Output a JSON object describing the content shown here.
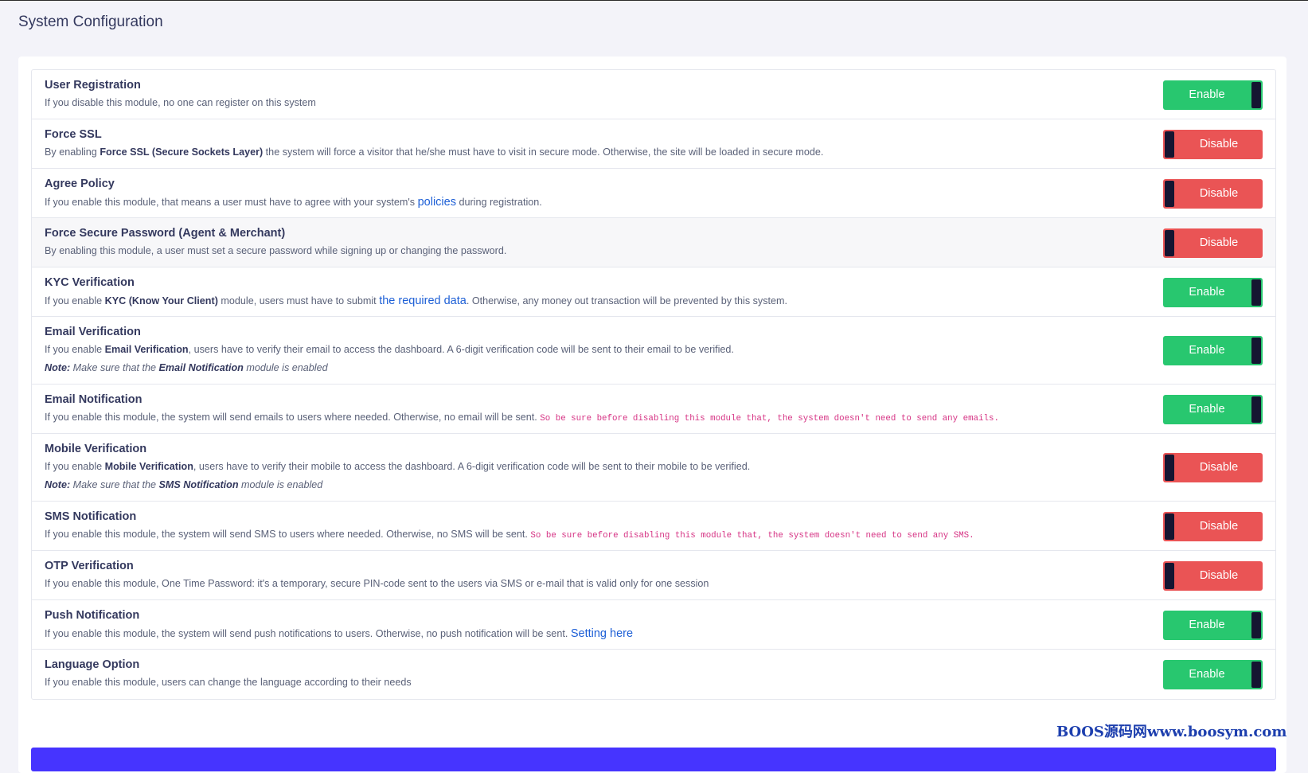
{
  "page": {
    "title": "System Configuration"
  },
  "rows": [
    {
      "title": "User Registration",
      "desc": [
        {
          "t": "text",
          "v": "If you disable this module, no one can register on this system"
        }
      ],
      "toggle": "Enable",
      "enabled": true
    },
    {
      "title": "Force SSL",
      "desc": [
        {
          "t": "text",
          "v": "By enabling "
        },
        {
          "t": "bold",
          "v": "Force SSL (Secure Sockets Layer)"
        },
        {
          "t": "text",
          "v": " the system will force a visitor that he/she must have to visit in secure mode. Otherwise, the site will be loaded in secure mode."
        }
      ],
      "toggle": "Disable",
      "enabled": false
    },
    {
      "title": "Agree Policy",
      "desc": [
        {
          "t": "text",
          "v": "If you enable this module, that means a user must have to agree with your system's "
        },
        {
          "t": "link",
          "v": "policies"
        },
        {
          "t": "text",
          "v": " during registration."
        }
      ],
      "toggle": "Disable",
      "enabled": false
    },
    {
      "title": "Force Secure Password (Agent & Merchant)",
      "desc": [
        {
          "t": "text",
          "v": "By enabling this module, a user must set a secure password while signing up or changing the password."
        }
      ],
      "toggle": "Disable",
      "enabled": false,
      "shaded": true
    },
    {
      "title": "KYC Verification",
      "desc": [
        {
          "t": "text",
          "v": "If you enable "
        },
        {
          "t": "bold",
          "v": "KYC (Know Your Client)"
        },
        {
          "t": "text",
          "v": " module, users must have to submit "
        },
        {
          "t": "link",
          "v": "the required data"
        },
        {
          "t": "text",
          "v": ". Otherwise, any money out transaction will be prevented by this system."
        }
      ],
      "toggle": "Enable",
      "enabled": true
    },
    {
      "title": "Email Verification",
      "desc": [
        {
          "t": "text",
          "v": "If you enable "
        },
        {
          "t": "bold",
          "v": "Email Verification"
        },
        {
          "t": "text",
          "v": ", users have to verify their email to access the dashboard. A 6-digit verification code will be sent to their email to be verified."
        }
      ],
      "note": [
        {
          "t": "bold",
          "v": "Note:"
        },
        {
          "t": "text",
          "v": " Make sure that the "
        },
        {
          "t": "bold",
          "v": "Email Notification"
        },
        {
          "t": "text",
          "v": " module is enabled"
        }
      ],
      "toggle": "Enable",
      "enabled": true
    },
    {
      "title": "Email Notification",
      "desc": [
        {
          "t": "text",
          "v": "If you enable this module, the system will send emails to users where needed. Otherwise, no email will be sent. "
        },
        {
          "t": "code",
          "v": "So be sure before disabling this module that, the system doesn't need to send any emails."
        }
      ],
      "toggle": "Enable",
      "enabled": true
    },
    {
      "title": "Mobile Verification",
      "desc": [
        {
          "t": "text",
          "v": "If you enable "
        },
        {
          "t": "bold",
          "v": "Mobile Verification"
        },
        {
          "t": "text",
          "v": ", users have to verify their mobile to access the dashboard. A 6-digit verification code will be sent to their mobile to be verified."
        }
      ],
      "note": [
        {
          "t": "bold",
          "v": "Note:"
        },
        {
          "t": "text",
          "v": " Make sure that the "
        },
        {
          "t": "bold",
          "v": "SMS Notification"
        },
        {
          "t": "text",
          "v": " module is enabled"
        }
      ],
      "toggle": "Disable",
      "enabled": false
    },
    {
      "title": "SMS Notification",
      "desc": [
        {
          "t": "text",
          "v": "If you enable this module, the system will send SMS to users where needed. Otherwise, no SMS will be sent. "
        },
        {
          "t": "code",
          "v": "So be sure before disabling this module that, the system doesn't need to send any SMS."
        }
      ],
      "toggle": "Disable",
      "enabled": false
    },
    {
      "title": "OTP Verification",
      "desc": [
        {
          "t": "text",
          "v": "If you enable this module, One Time Password: it's a temporary, secure PIN-code sent to the users via SMS or e-mail that is valid only for one session"
        }
      ],
      "toggle": "Disable",
      "enabled": false
    },
    {
      "title": "Push Notification",
      "desc": [
        {
          "t": "text",
          "v": "If you enable this module, the system will send push notifications to users. Otherwise, no push notification will be sent. "
        },
        {
          "t": "link",
          "v": "Setting here"
        }
      ],
      "toggle": "Enable",
      "enabled": true
    },
    {
      "title": "Language Option",
      "desc": [
        {
          "t": "text",
          "v": "If you enable this module, users can change the language according to their needs"
        }
      ],
      "toggle": "Enable",
      "enabled": true
    }
  ],
  "watermark": "BOOS源码网www.boosym.com",
  "colors": {
    "enable": "#28c76f",
    "disable": "#ea5455",
    "knob": "#151531",
    "link": "#1d5fd6",
    "primary": "#4634ff"
  }
}
